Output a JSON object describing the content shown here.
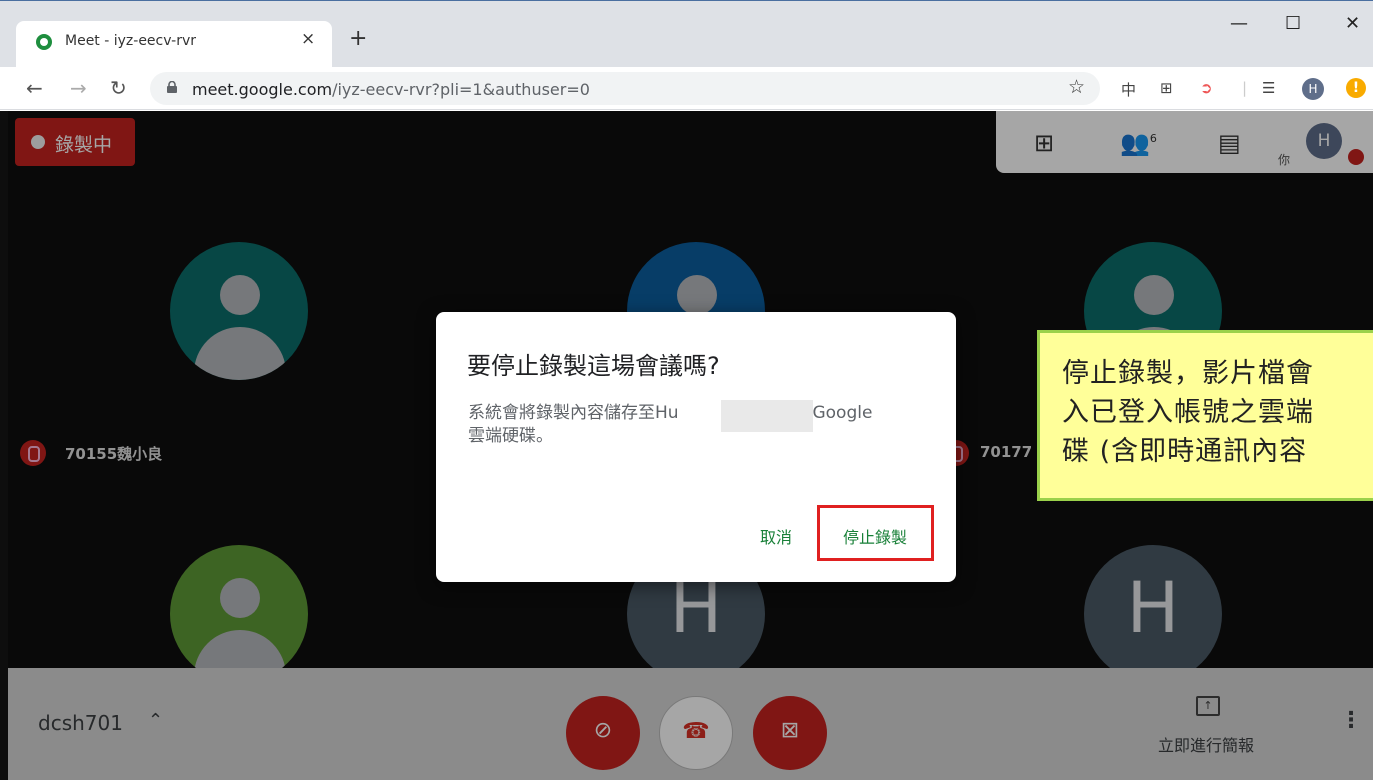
{
  "browser": {
    "tab_title": "Meet - iyz-eecv-rvr",
    "tab_close": "×",
    "new_tab": "+",
    "window_minimize": "—",
    "window_maximize": "☐",
    "window_close": "✕",
    "url_host": "meet.google.com",
    "url_rest": "/iyz-eecv-rvr?pli=1&authuser=0",
    "profile_initial": "H",
    "update_badge": "!",
    "ext_translate": "中"
  },
  "meet": {
    "recording_badge": "錄製中",
    "self_label": "你",
    "people_count": "6",
    "participants": [
      {
        "name": "70155魏小良",
        "muted": true
      },
      {
        "name": "70177",
        "muted": true
      }
    ],
    "tile_letters": [
      "H",
      "H"
    ],
    "colors": {
      "teal": "#0b6e6a",
      "blue": "#0b5e9f",
      "green": "#5e9a36",
      "slate": "#4a5a66"
    }
  },
  "dialog": {
    "title": "要停止錄製這場會議嗎?",
    "body_prefix": "系統會將錄製內容儲存至Hu",
    "body_suffix": "ui的 Google",
    "body_line2": "雲端硬碟。",
    "cancel_label": "取消",
    "stop_label": "停止錄製"
  },
  "callout": {
    "line1": "停止錄製，影片檔會",
    "line2": "入已登入帳號之雲端",
    "line3": "碟 (含即時通訊內容"
  },
  "bottombar": {
    "meeting_code": "dcsh701",
    "present_label": "立即進行簡報"
  }
}
